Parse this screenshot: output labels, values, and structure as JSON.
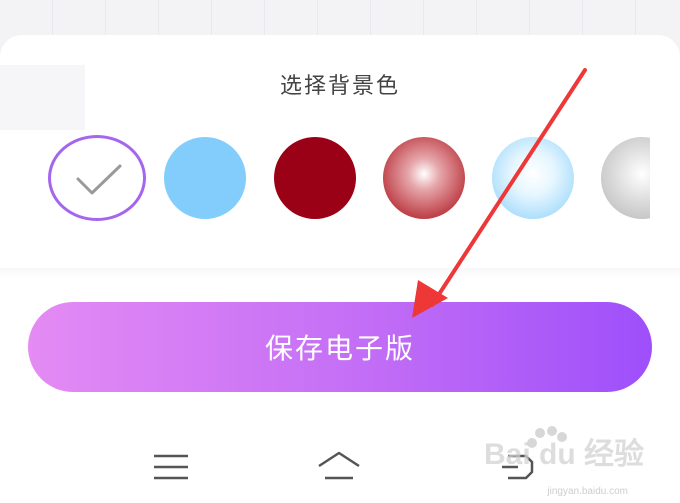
{
  "sheet": {
    "title": "选择背景色"
  },
  "swatches": [
    {
      "name": "selected-white",
      "color": "#ffffff",
      "selected": true
    },
    {
      "name": "light-blue",
      "color": "#82cdfb",
      "selected": false
    },
    {
      "name": "dark-red",
      "color": "#9a0016",
      "selected": false
    },
    {
      "name": "red-gradient",
      "color": "#c0444c",
      "selected": false
    },
    {
      "name": "blue-gradient",
      "color": "#9dd8fb",
      "selected": false
    },
    {
      "name": "gray-gradient",
      "color": "#b4b4b4",
      "selected": false
    }
  ],
  "save_button": {
    "label": "保存电子版"
  },
  "nav": {
    "items": [
      "menu-icon",
      "home-icon",
      "back-icon"
    ]
  },
  "colors": {
    "accent_border": "#a566ee",
    "button_gradient_start": "#e48bf4",
    "button_gradient_end": "#9e4ffa",
    "annotation_arrow": "#ee3838"
  },
  "watermark": {
    "brand": "Bai du 经验",
    "url": "jingyan.baidu.com"
  }
}
